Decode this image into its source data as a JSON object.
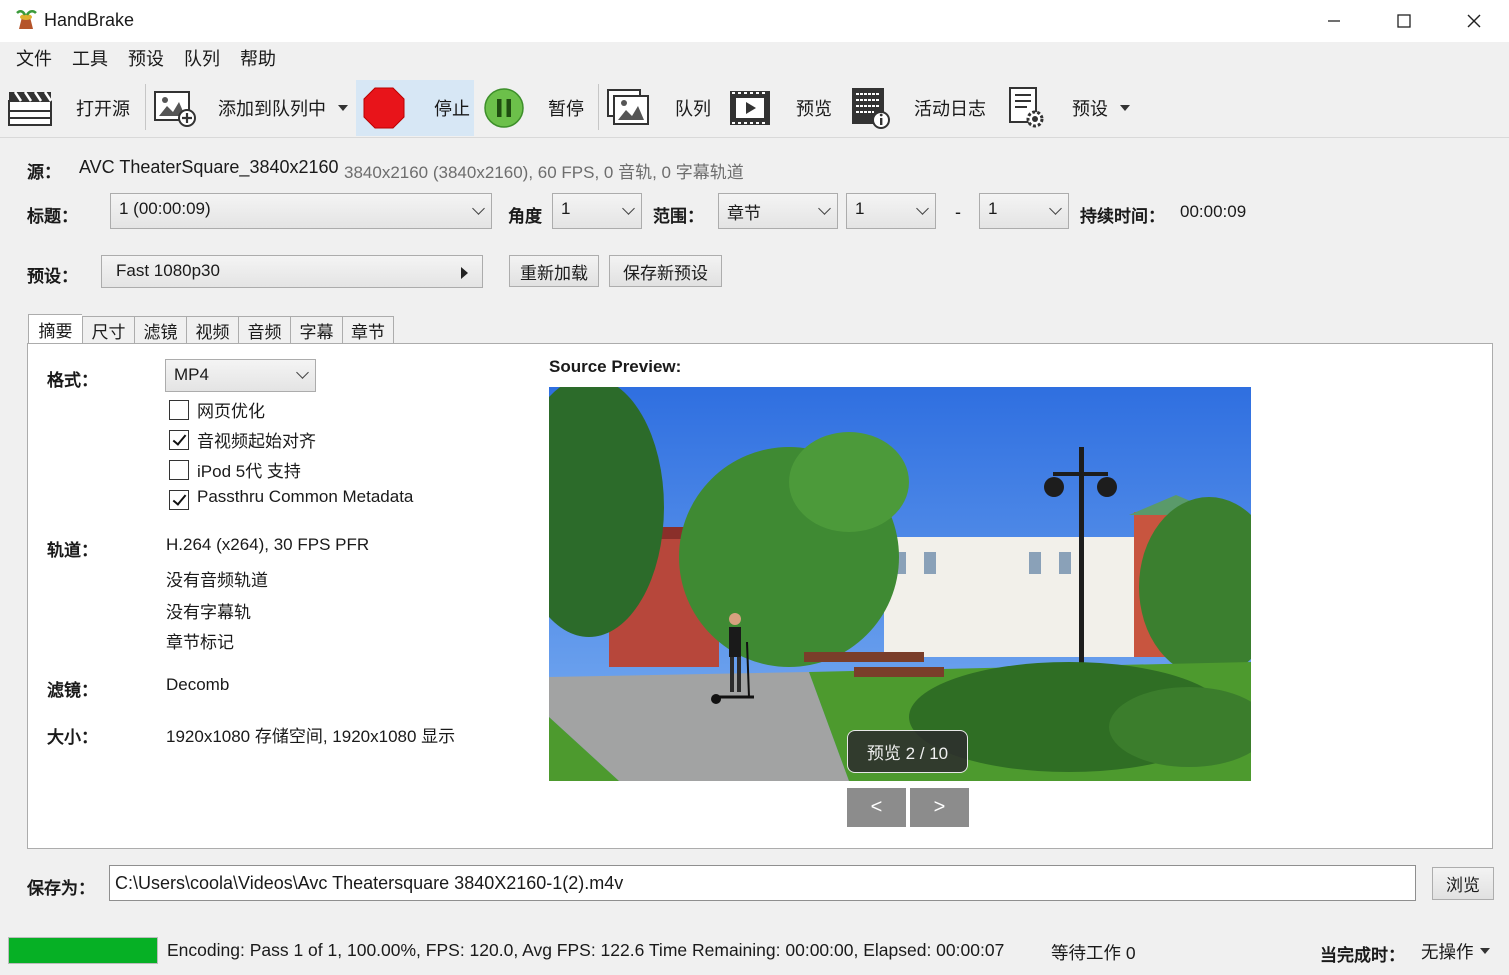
{
  "window": {
    "title": "HandBrake",
    "minimize": "─",
    "maximize": "☐",
    "close": "✕"
  },
  "menu": [
    "文件",
    "工具",
    "预设",
    "队列",
    "帮助"
  ],
  "toolbar": {
    "open_source": "打开源",
    "add_to_queue": "添加到队列中",
    "stop": "停止",
    "pause": "暂停",
    "queue": "队列",
    "preview": "预览",
    "activity_log": "活动日志",
    "presets": "预设"
  },
  "source": {
    "label": "源：",
    "name": "AVC TheaterSquare_3840x2160",
    "info": "3840x2160 (3840x2160), 60 FPS, 0 音轨, 0 字幕轨道"
  },
  "title_row": {
    "title_label": "标题：",
    "title_value": "1 (00:00:09)",
    "angle_label": "角度",
    "angle_value": "1",
    "range_label": "范围：",
    "range_type": "章节",
    "range_start": "1",
    "range_dash": "-",
    "range_end": "1",
    "duration_label": "持续时间：",
    "duration_value": "00:00:09"
  },
  "preset_row": {
    "label": "预设：",
    "value": "Fast 1080p30",
    "reload_button": "重新加载",
    "save_new_button": "保存新预设"
  },
  "tabs": [
    "摘要",
    "尺寸",
    "滤镜",
    "视频",
    "音频",
    "字幕",
    "章节"
  ],
  "summary": {
    "format_label": "格式：",
    "format_value": "MP4",
    "options": [
      {
        "label": "网页优化",
        "checked": false
      },
      {
        "label": "音视频起始对齐",
        "checked": true
      },
      {
        "label": "iPod 5代 支持",
        "checked": false
      },
      {
        "label": "Passthru Common Metadata",
        "checked": true
      }
    ],
    "tracks_label": "轨道：",
    "tracks": [
      "H.264 (x264), 30 FPS PFR",
      "没有音频轨道",
      "没有字幕轨",
      "章节标记"
    ],
    "filters_label": "滤镜：",
    "filters_value": "Decomb",
    "size_label": "大小：",
    "size_value": "1920x1080 存储空间, 1920x1080 显示",
    "preview_title": "Source Preview:",
    "preview_counter": "预览 2 / 10",
    "prev_button": "<",
    "next_button": ">"
  },
  "save_as": {
    "label": "保存为：",
    "path": "C:\\Users\\coola\\Videos\\Avc Theatersquare 3840X2160-1(2).m4v",
    "browse_button": "浏览"
  },
  "status": {
    "progress_percent": 100,
    "progress_color": "#06b025",
    "encoding_text": "Encoding: Pass 1 of 1,  100.00%, FPS: 120.0,  Avg FPS: 122.6 Time Remaining: 00:00:00,  Elapsed: 00:00:07",
    "pending_jobs": "等待工作 0",
    "when_done_label": "当完成时：",
    "when_done_value": "无操作"
  }
}
